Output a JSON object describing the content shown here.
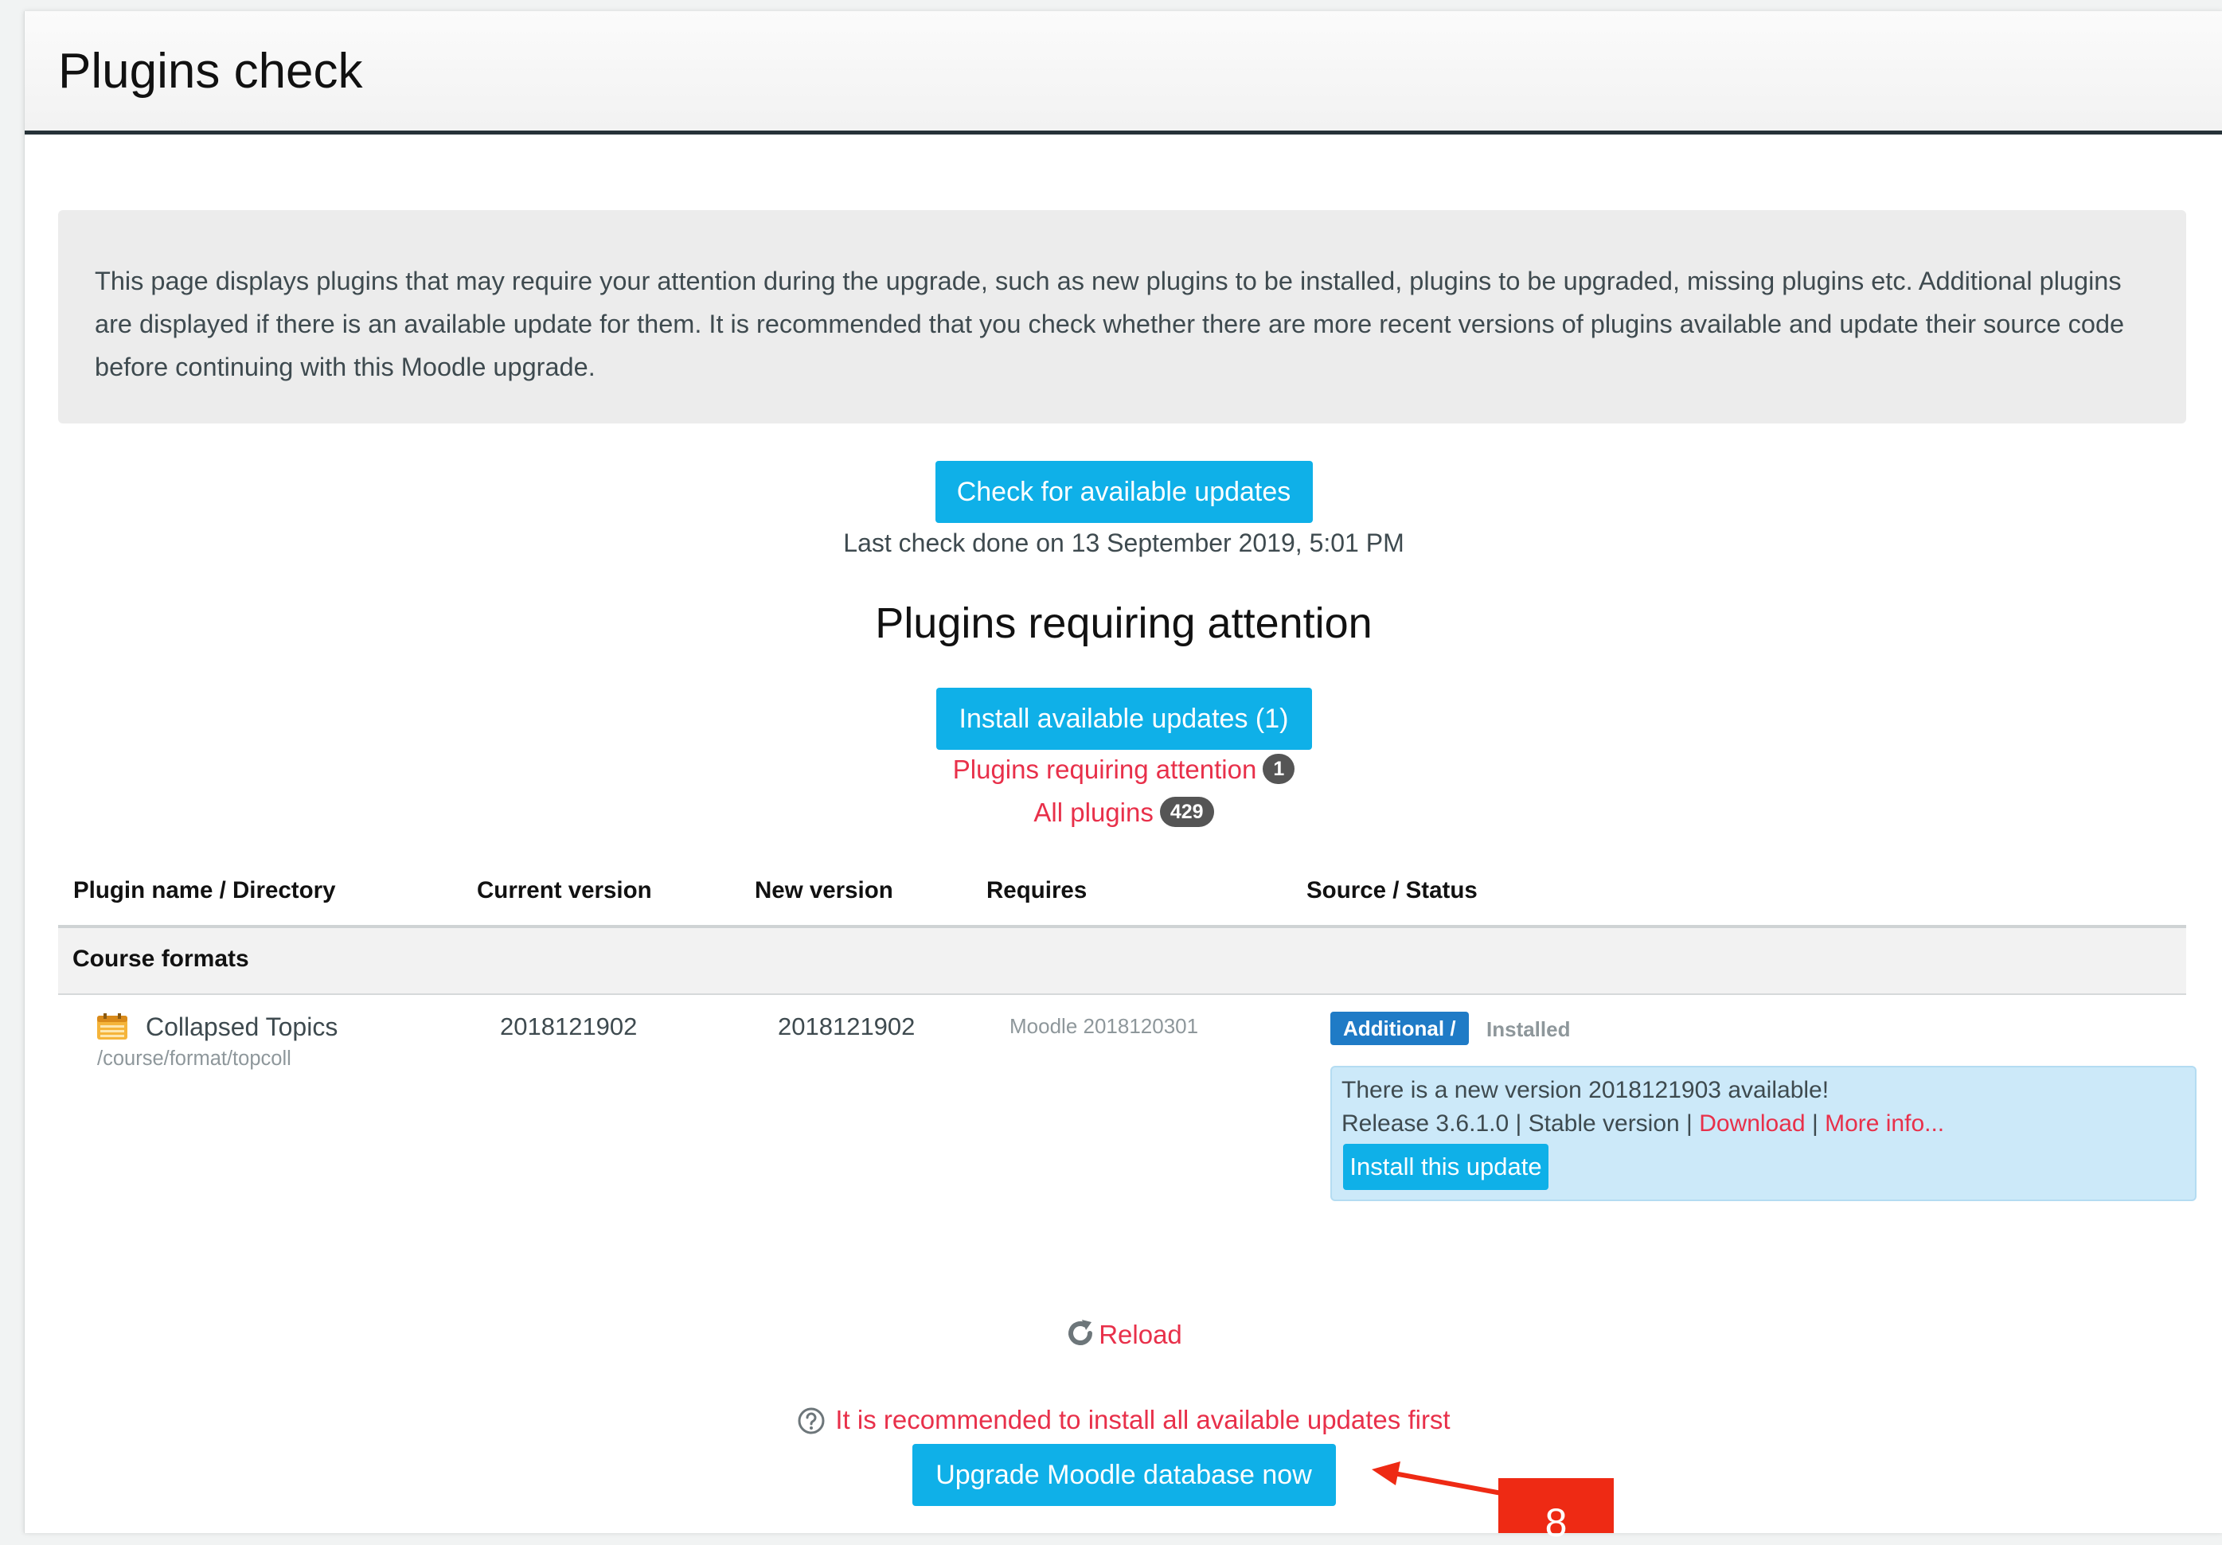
{
  "header": {
    "title": "Plugins check"
  },
  "intro": {
    "text": "This page displays plugins that may require your attention during the upgrade, such as new plugins to be installed, plugins to be upgraded, missing plugins etc. Additional plugins are displayed if there is an available update for them. It is recommended that you check whether there are more recent versions of plugins available and update their source code before continuing with this Moodle upgrade."
  },
  "updates": {
    "check_button": "Check for available updates",
    "last_check": "Last check done on 13 September 2019, 5:01 PM"
  },
  "attention": {
    "heading": "Plugins requiring attention",
    "install_button": "Install available updates (1)",
    "filter_attention_label": "Plugins requiring attention",
    "filter_attention_count": "1",
    "filter_all_label": "All plugins",
    "filter_all_count": "429"
  },
  "table": {
    "headers": [
      "Plugin name / Directory",
      "Current version",
      "New version",
      "Requires",
      "Source / Status"
    ],
    "group": "Course formats",
    "row": {
      "icon": "calendar-icon",
      "name": "Collapsed Topics",
      "directory": "/course/format/topcoll",
      "current_version": "2018121902",
      "new_version": "2018121902",
      "requires": "Moodle 2018120301",
      "source": "Additional /",
      "status": "Installed",
      "update": {
        "message": "There is a new version 2018121903 available!",
        "release": "Release 3.6.1.0 | Stable version | ",
        "download_link": "Download",
        "separator": " | ",
        "more_info_link": "More info...",
        "install_button": "Install this update"
      }
    }
  },
  "footer": {
    "reload_icon": "reload-icon",
    "reload_link": "Reload",
    "recommend_icon": "help-circle-icon",
    "recommend_text": "It is recommended to install all available updates first",
    "upgrade_button": "Upgrade Moodle database now"
  },
  "annotation": {
    "number": "8",
    "color": "#ee2a14"
  },
  "colors": {
    "primary_button": "#0fb0e8",
    "link_red": "#e8304a",
    "badge_blue": "#1f7bc6",
    "update_box": "#cce9f9",
    "header_rule": "#263238"
  }
}
